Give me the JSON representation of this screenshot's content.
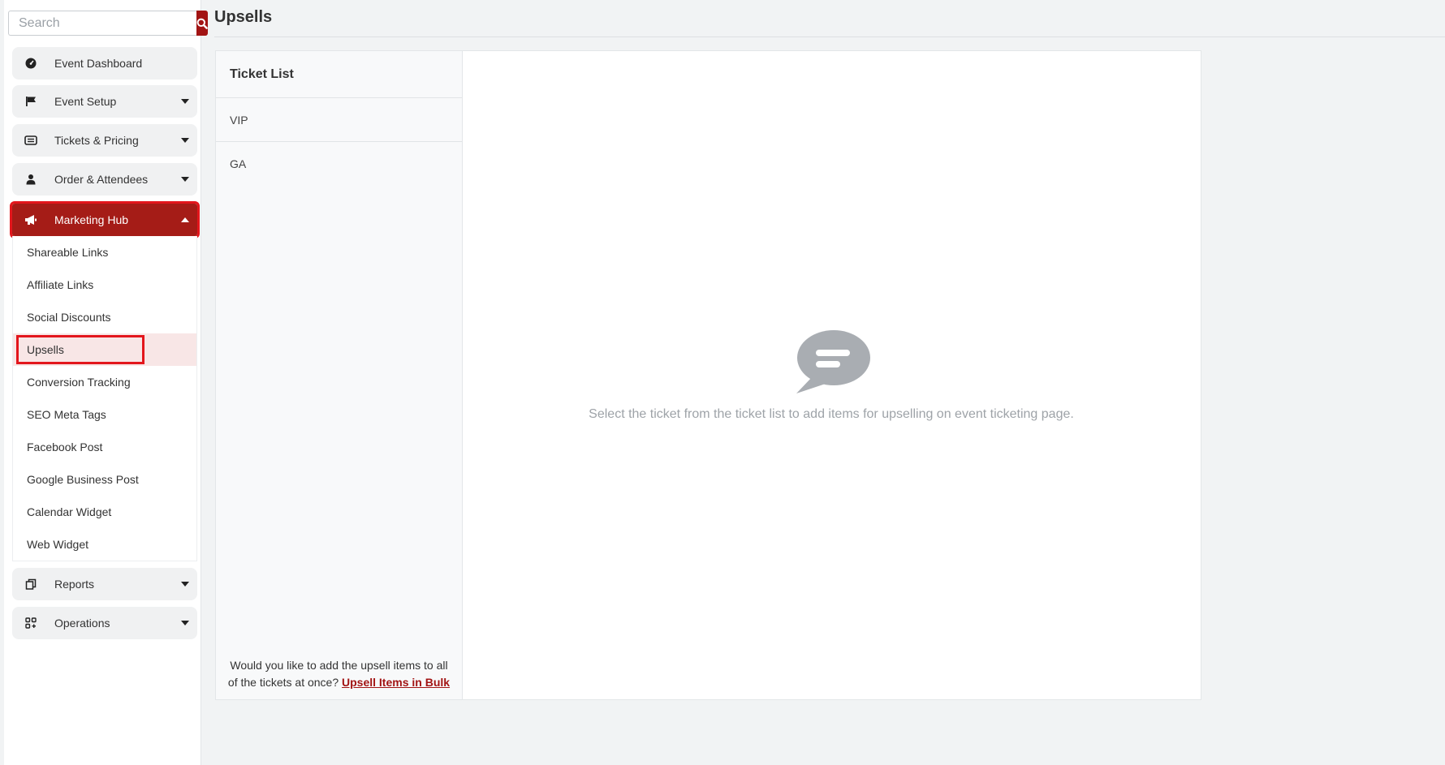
{
  "search": {
    "placeholder": "Search",
    "icon": "search-icon"
  },
  "sidebar": {
    "items": [
      {
        "label": "Event Dashboard",
        "icon": "dashboard-gauge-icon"
      },
      {
        "label": "Event Setup",
        "icon": "flag-icon"
      },
      {
        "label": "Tickets & Pricing",
        "icon": "ticket-icon"
      },
      {
        "label": "Order & Attendees",
        "icon": "user-icon"
      },
      {
        "label": "Marketing Hub",
        "icon": "megaphone-icon"
      },
      {
        "label": "Reports",
        "icon": "copy-icon"
      },
      {
        "label": "Operations",
        "icon": "apps-add-icon"
      }
    ],
    "marketing_submenu": [
      "Shareable Links",
      "Affiliate Links",
      "Social Discounts",
      "Upsells",
      "Conversion Tracking",
      "SEO Meta Tags",
      "Facebook Post",
      "Google Business Post",
      "Calendar Widget",
      "Web Widget"
    ]
  },
  "page": {
    "title": "Upsells"
  },
  "ticket_list": {
    "header": "Ticket List",
    "tickets": [
      "VIP",
      "GA"
    ],
    "bulk_text": "Would you like to add the upsell items to all of the tickets at once?",
    "bulk_link": "Upsell Items in Bulk"
  },
  "empty_state": {
    "icon": "chat-bubble-icon",
    "message": "Select the ticket from the ticket list to add items for upselling on event ticketing page."
  },
  "colors": {
    "brand": "#a21414",
    "highlight": "#e3161c",
    "selected_bg": "#f8e6e6"
  }
}
